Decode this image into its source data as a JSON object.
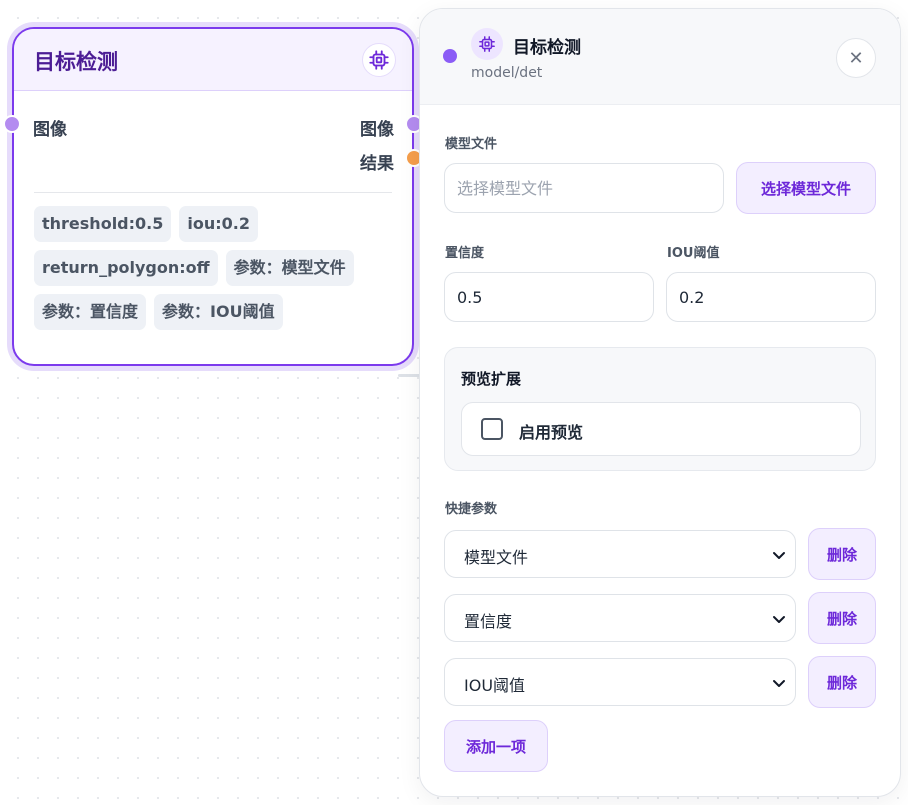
{
  "node": {
    "title": "目标检测",
    "icon": "chip-icon",
    "input_port_label": "图像",
    "output_ports": [
      "图像",
      "结果"
    ],
    "port_colors": {
      "input": "#b48cf0",
      "image_out": "#b48cf0",
      "result_out": "#f59e4b"
    },
    "tags": [
      "threshold:0.5",
      "iou:0.2",
      "return_polygon:off",
      "参数：模型文件",
      "参数：置信度",
      "参数：IOU阈值"
    ]
  },
  "panel": {
    "title": "目标检测",
    "subtitle": "model/det",
    "icon": "chip-icon",
    "close_glyph": "✕",
    "model_file": {
      "label": "模型文件",
      "value": "",
      "placeholder": "选择模型文件",
      "button": "选择模型文件"
    },
    "confidence": {
      "label": "置信度",
      "value": "0.5"
    },
    "iou": {
      "label": "IOU阈值",
      "value": "0.2"
    },
    "preview": {
      "title": "预览扩展",
      "toggle_label": "启用预览",
      "checked": false
    },
    "quick_params": {
      "label": "快捷参数",
      "items": [
        {
          "value": "模型文件",
          "delete_label": "删除"
        },
        {
          "value": "置信度",
          "delete_label": "删除"
        },
        {
          "value": "IOU阈值",
          "delete_label": "删除"
        }
      ],
      "add_label": "添加一项"
    }
  },
  "colors": {
    "accent": "#7c3aed",
    "accent_text": "#6d28d9",
    "accent_soft": "#f3eeff",
    "title_purple": "#4c1d95"
  }
}
